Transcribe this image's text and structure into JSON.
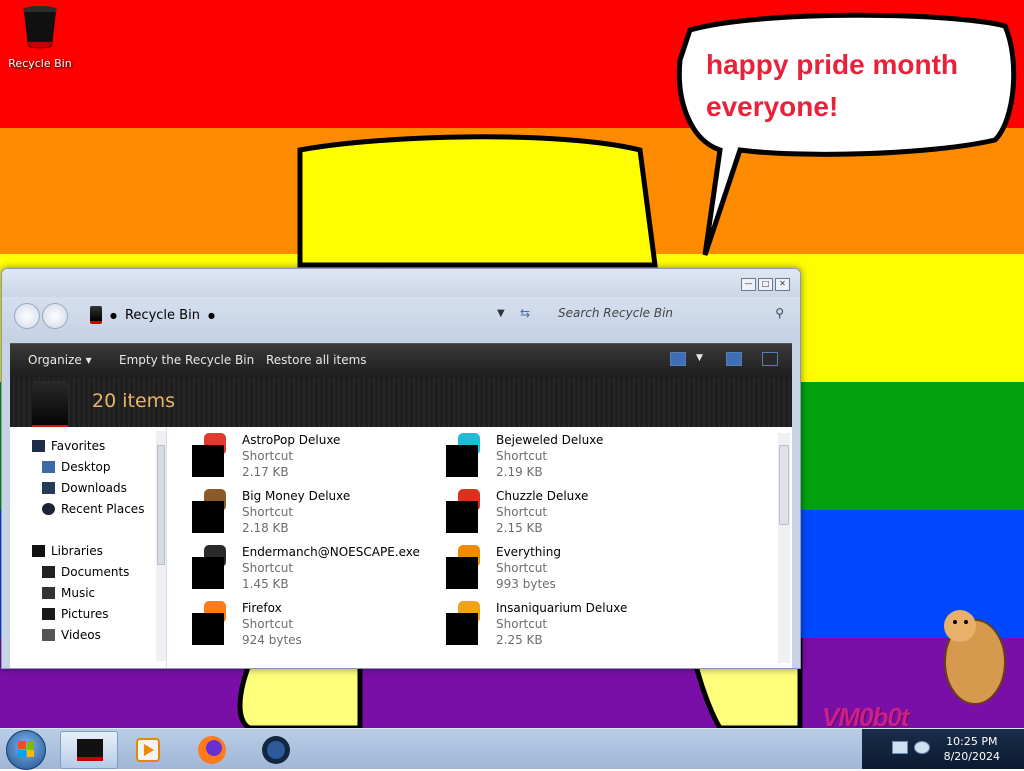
{
  "desktop": {
    "recycle_bin_label": "Recycle Bin",
    "bubble_text": "happy pride month everyone!",
    "watermark": "VM0b0t"
  },
  "window": {
    "breadcrumb": "Recycle Bin",
    "search_placeholder": "Search Recycle Bin",
    "toolbar": {
      "organize": "Organize",
      "empty": "Empty the Recycle Bin",
      "restore": "Restore all items"
    },
    "header_count": "20 items",
    "nav": {
      "favorites": "Favorites",
      "desktop": "Desktop",
      "downloads": "Downloads",
      "recent": "Recent Places",
      "libraries": "Libraries",
      "documents": "Documents",
      "music": "Music",
      "pictures": "Pictures",
      "videos": "Videos"
    },
    "files": [
      {
        "name": "AstroPop Deluxe",
        "type": "Shortcut",
        "size": "2.17 KB",
        "hint": "#e23b2e"
      },
      {
        "name": "Bejeweled Deluxe",
        "type": "Shortcut",
        "size": "2.19 KB",
        "hint": "#22b8d6"
      },
      {
        "name": "Big Money Deluxe",
        "type": "Shortcut",
        "size": "2.18 KB",
        "hint": "#8a5a2b"
      },
      {
        "name": "Chuzzle Deluxe",
        "type": "Shortcut",
        "size": "2.15 KB",
        "hint": "#d8321f"
      },
      {
        "name": "Endermanch@NOESCAPE.exe",
        "type": "Shortcut",
        "size": "1.45 KB",
        "hint": "#2a2a2a"
      },
      {
        "name": "Everything",
        "type": "Shortcut",
        "size": "993 bytes",
        "hint": "#f08a00"
      },
      {
        "name": "Firefox",
        "type": "Shortcut",
        "size": "924 bytes",
        "hint": "#ff7a1a"
      },
      {
        "name": "Insaniquarium Deluxe",
        "type": "Shortcut",
        "size": "2.25 KB",
        "hint": "#f2a21a"
      }
    ]
  },
  "taskbar": {
    "time": "10:25 PM",
    "date": "8/20/2024"
  }
}
